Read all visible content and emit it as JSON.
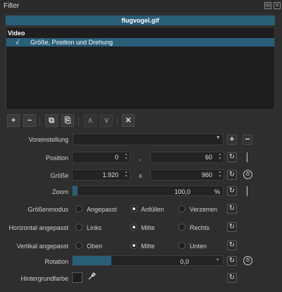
{
  "panel": {
    "title": "Filter"
  },
  "clip": {
    "name": "flugvogel.gif"
  },
  "filter_list": {
    "section": "Video",
    "items": [
      {
        "checked": "√",
        "label": "Größe, Position und Drehung"
      }
    ]
  },
  "toolbar": {
    "add": "+",
    "remove": "−",
    "copy": "⧉",
    "paste": "⎘",
    "up": "∧",
    "down": "∨",
    "close": "✕"
  },
  "preset": {
    "label": "Voreinstellung",
    "value": "",
    "add": "+",
    "remove": "−"
  },
  "position": {
    "label": "Position",
    "x": "0",
    "sep": ",",
    "y": "60"
  },
  "size": {
    "label": "Größe",
    "w": "1.920",
    "sep": "x",
    "h": "960"
  },
  "zoom": {
    "label": "Zoom",
    "value": "100,0",
    "unit": "%",
    "fraction": 0.035
  },
  "size_mode": {
    "label": "Größenmodus",
    "options": [
      "Angepasst",
      "Anfüllen",
      "Verzerren"
    ],
    "selected": "Anfüllen"
  },
  "h_align": {
    "label": "Horizontal angepasst",
    "options": [
      "Links",
      "Mitte",
      "Rechts"
    ],
    "selected": "Mitte"
  },
  "v_align": {
    "label": "Vertikal angepasst",
    "options": [
      "Oben",
      "Mitte",
      "Unten"
    ],
    "selected": "Mitte"
  },
  "rotation": {
    "label": "Rotation",
    "value": "0,0",
    "unit": "°",
    "fraction": 0.26
  },
  "background": {
    "label": "Hintergrundfarbe",
    "color": "#1e1e1e"
  },
  "icons": {
    "reset": "↻",
    "keyframe": "⏱"
  },
  "colors": {
    "accent": "#2a5f7a",
    "panel": "#2e2e2e",
    "field": "#232323"
  }
}
